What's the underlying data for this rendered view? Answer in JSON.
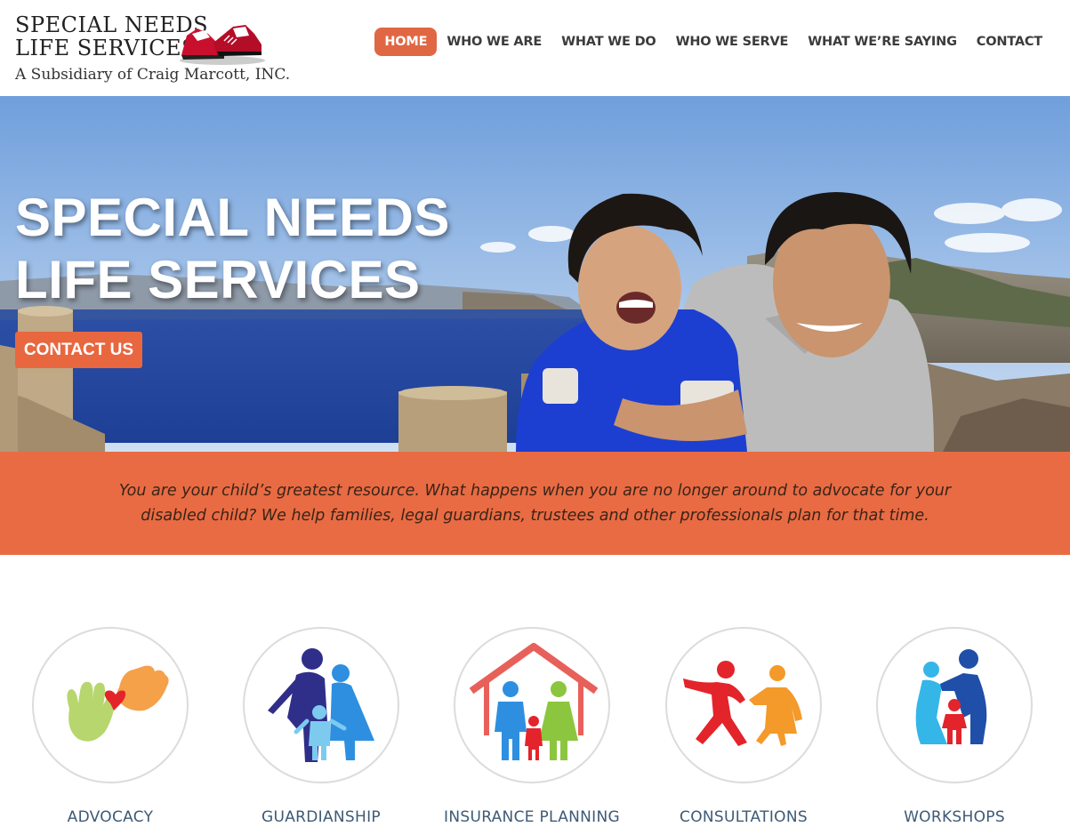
{
  "brand": {
    "line1": "SPECIAL NEEDS",
    "line2": "LIFE SERVICES",
    "tagline": "A Subsidiary of Craig Marcott, INC."
  },
  "nav": {
    "items": [
      {
        "label": "HOME",
        "active": true
      },
      {
        "label": "WHO WE ARE"
      },
      {
        "label": "WHAT WE DO"
      },
      {
        "label": "WHO WE SERVE"
      },
      {
        "label": "WHAT WE’RE SAYING"
      },
      {
        "label": "CONTACT"
      }
    ]
  },
  "hero": {
    "title_line1": "SPECIAL NEEDS",
    "title_line2": "LIFE SERVICES",
    "cta_label": "CONTACT US"
  },
  "intro": {
    "line1": "You are your child’s greatest resource. What happens when you are no longer around to advocate for your",
    "line2": "disabled child? We help families, legal guardians, trustees and other professionals plan for that time."
  },
  "services": [
    {
      "label": "ADVOCACY",
      "icon": "hands-heart-icon"
    },
    {
      "label": "GUARDIANSHIP",
      "icon": "family-icon"
    },
    {
      "label": "INSURANCE PLANNING",
      "icon": "house-family-icon"
    },
    {
      "label": "CONSULTATIONS",
      "icon": "people-reaching-icon"
    },
    {
      "label": "WORKSHOPS",
      "icon": "parents-child-icon"
    }
  ],
  "colors": {
    "accent": "#e8673f",
    "band": "#e96b43",
    "label": "#3d5a75"
  }
}
